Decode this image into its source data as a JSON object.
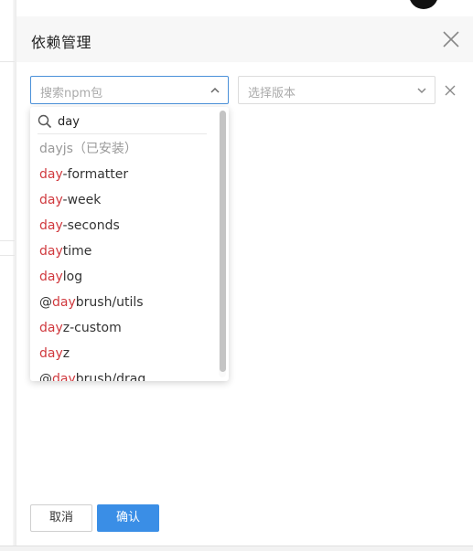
{
  "drawer": {
    "title": "依赖管理"
  },
  "package_select": {
    "placeholder": "搜索npm包"
  },
  "version_select": {
    "placeholder": "选择版本"
  },
  "dropdown": {
    "search_value": "day",
    "items": [
      {
        "prefix": "",
        "highlight": "",
        "suffix": "dayjs（已安装）",
        "installed": true
      },
      {
        "prefix": "",
        "highlight": "day",
        "suffix": "-formatter",
        "installed": false
      },
      {
        "prefix": "",
        "highlight": "day",
        "suffix": "-week",
        "installed": false
      },
      {
        "prefix": "",
        "highlight": "day",
        "suffix": "-seconds",
        "installed": false
      },
      {
        "prefix": "",
        "highlight": "day",
        "suffix": "time",
        "installed": false
      },
      {
        "prefix": "",
        "highlight": "day",
        "suffix": "log",
        "installed": false
      },
      {
        "prefix": "@",
        "highlight": "day",
        "suffix": "brush/utils",
        "installed": false
      },
      {
        "prefix": "",
        "highlight": "day",
        "suffix": "z-custom",
        "installed": false
      },
      {
        "prefix": "",
        "highlight": "day",
        "suffix": "z",
        "installed": false
      },
      {
        "prefix": "@",
        "highlight": "day",
        "suffix": "brush/drag",
        "installed": false
      }
    ]
  },
  "footer": {
    "cancel_label": "取消",
    "confirm_label": "确认"
  },
  "colors": {
    "accent": "#3a8ee6",
    "highlight": "#d0393e",
    "installed_text": "#999999"
  },
  "icons": {
    "close": "close-icon",
    "chevron_up": "chevron-up-icon",
    "chevron_down": "chevron-down-icon",
    "search": "search-icon",
    "clear_row": "clear-row-icon"
  }
}
